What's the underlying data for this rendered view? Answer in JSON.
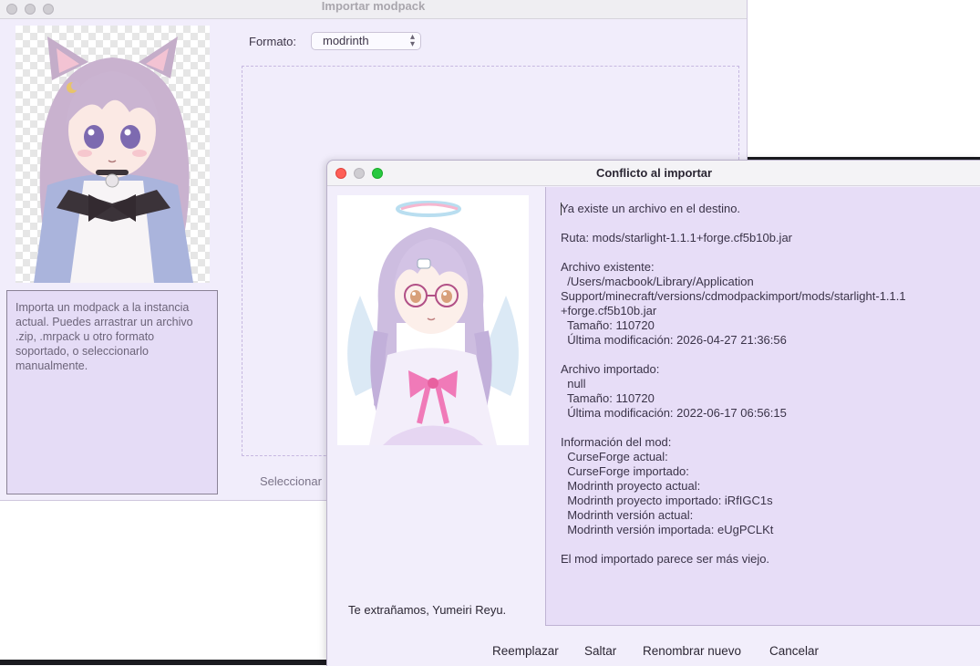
{
  "main_window": {
    "title": "Importar modpack",
    "description": "Importa un modpack a la instancia actual. Puedes arrastrar un archivo .zip, .mrpack u otro formato soportado, o seleccionarlo manualmente.",
    "format_label": "Formato:",
    "format_value": "modrinth",
    "select_manual_label": "Seleccionar"
  },
  "dialog": {
    "title": "Conflicto al importar",
    "farewell": "Te extrañamos, Yumeiri Reyu.",
    "message_lines": [
      "Ya existe un archivo en el destino.",
      "",
      "Ruta: mods/starlight-1.1.1+forge.cf5b10b.jar",
      "",
      "Archivo existente:",
      "  /Users/macbook/Library/Application",
      "Support/minecraft/versions/cdmodpackimport/mods/starlight-1.1.1",
      "+forge.cf5b10b.jar",
      "  Tamaño: 110720",
      "  Última modificación: 2026-04-27 21:36:56",
      "",
      "Archivo importado:",
      "  null",
      "  Tamaño: 110720",
      "  Última modificación: 2022-06-17 06:56:15",
      "",
      "Información del mod:",
      "  CurseForge actual:",
      "  CurseForge importado:",
      "  Modrinth proyecto actual:",
      "  Modrinth proyecto importado: iRfIGC1s",
      "  Modrinth versión actual:",
      "  Modrinth versión importada: eUgPCLKt",
      "",
      "El mod importado parece ser más viejo."
    ],
    "buttons": {
      "replace": "Reemplazar",
      "skip": "Saltar",
      "rename_new": "Renombrar nuevo",
      "cancel": "Cancelar"
    }
  },
  "colors": {
    "accent_lavender": "#e7ddf7",
    "traffic_red": "#fe5f57",
    "traffic_green": "#28c840"
  }
}
